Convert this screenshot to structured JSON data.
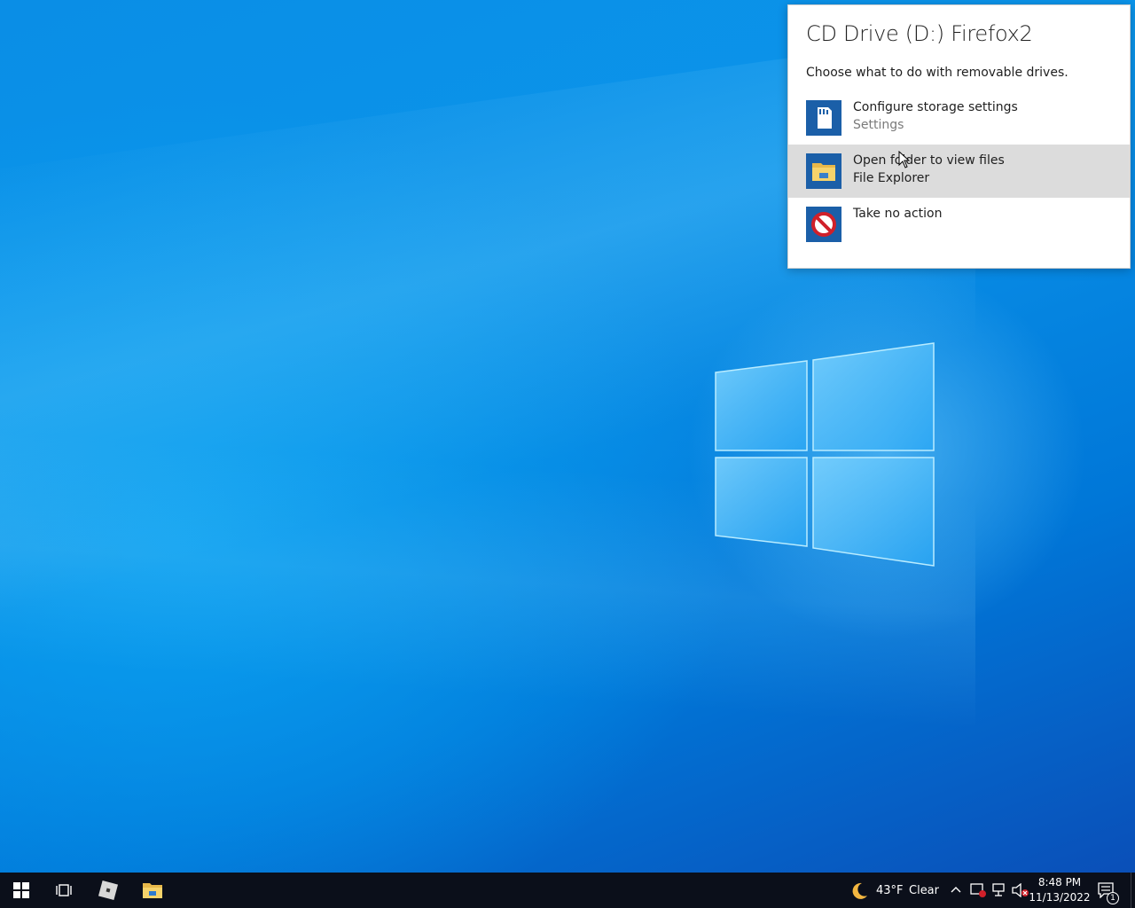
{
  "toast": {
    "title": "CD Drive (D:) Firefox2",
    "subtitle": "Choose what to do with removable drives.",
    "options": [
      {
        "label": "Configure storage settings",
        "sub": "Settings",
        "icon": "sd-card-icon"
      },
      {
        "label": "Open folder to view files",
        "sub": "File Explorer",
        "icon": "folder-icon"
      },
      {
        "label": "Take no action",
        "sub": "",
        "icon": "no-entry-icon"
      }
    ]
  },
  "taskbar": {
    "start_icon": "windows-start-icon",
    "pinned": [
      "task-view-icon",
      "roblox-icon",
      "file-explorer-icon"
    ]
  },
  "tray": {
    "weather_temp": "43°F",
    "weather_cond": "Clear",
    "weather_icon": "moon-icon",
    "time": "8:48 PM",
    "date": "11/13/2022",
    "notification_count": "1"
  },
  "colors": {
    "accent": "#1b5fa8",
    "hover": "#dcdcdc",
    "taskbar": "#0b0f1a"
  }
}
